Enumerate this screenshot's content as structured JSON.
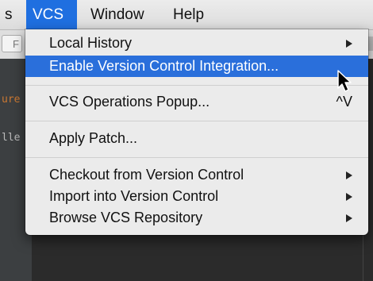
{
  "menubar": {
    "items": [
      {
        "label": "s"
      },
      {
        "label": "VCS"
      },
      {
        "label": "Window"
      },
      {
        "label": "Help"
      }
    ]
  },
  "background": {
    "toolbar_fragment": "F",
    "code_fragments": [
      "ure",
      "lle"
    ]
  },
  "vcs_menu": {
    "items": [
      {
        "label": "Local History",
        "submenu": true
      },
      {
        "label": "Enable Version Control Integration...",
        "highlighted": true
      },
      {
        "label": "VCS Operations Popup...",
        "shortcut": "^V"
      },
      {
        "label": "Apply Patch..."
      },
      {
        "label": "Checkout from Version Control",
        "submenu": true
      },
      {
        "label": "Import into Version Control",
        "submenu": true
      },
      {
        "label": "Browse VCS Repository",
        "submenu": true
      }
    ]
  },
  "colors": {
    "highlight": "#2a6fdb",
    "menu_bg": "#ebebeb"
  }
}
